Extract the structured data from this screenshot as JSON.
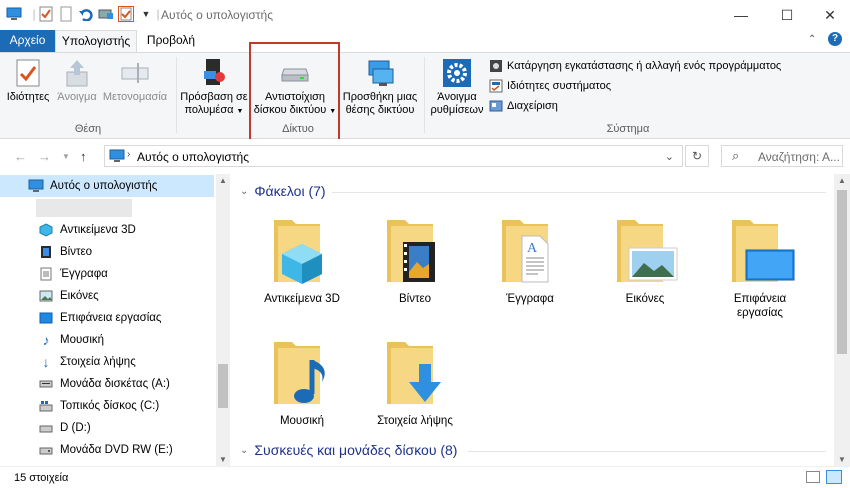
{
  "window": {
    "title": "Αυτός ο υπολογιστής",
    "minimize": "—",
    "maximize": "☐",
    "close": "✕"
  },
  "ribbon_tabs": [
    "Αρχείο",
    "Υπολογιστής",
    "Προβολή"
  ],
  "ribbon": {
    "location_group": {
      "label": "Θέση",
      "properties": "Ιδιότητες",
      "open": "Άνοιγμα",
      "rename": "Μετονομασία"
    },
    "network_group": {
      "label": "Δίκτυο",
      "media_access_1": "Πρόσβαση σε",
      "media_access_2": "πολυμέσα",
      "map_drive_1": "Αντιστοίχιση",
      "map_drive_2": "δίσκου δικτύου",
      "add_location_1": "Προσθήκη μιας",
      "add_location_2": "θέσης δικτύου"
    },
    "system_group": {
      "label": "Σύστημα",
      "open_settings_1": "Άνοιγμα",
      "open_settings_2": "ρυθμίσεων",
      "uninstall": "Κατάργηση εγκατάστασης ή αλλαγή ενός προγράμματος",
      "system_properties": "Ιδιότητες συστήματος",
      "manage": "Διαχείριση"
    }
  },
  "address": {
    "path": "Αυτός ο υπολογιστής",
    "search_placeholder": "Αναζήτηση: Α..."
  },
  "sidebar": {
    "items": [
      {
        "label": "Αυτός ο υπολογιστής"
      },
      {
        "label": ""
      },
      {
        "label": "Αντικείμενα 3D"
      },
      {
        "label": "Βίντεο"
      },
      {
        "label": "Έγγραφα"
      },
      {
        "label": "Εικόνες"
      },
      {
        "label": "Επιφάνεια εργασίας"
      },
      {
        "label": "Μουσική"
      },
      {
        "label": "Στοιχεία λήψης"
      },
      {
        "label": "Μονάδα δισκέτας (A:)"
      },
      {
        "label": "Τοπικός δίσκος (C:)"
      },
      {
        "label": "D (D:)"
      },
      {
        "label": "Μονάδα DVD RW (E:)"
      }
    ]
  },
  "main": {
    "folders_heading": "Φάκελοι (7)",
    "devices_heading": "Συσκευές και μονάδες δίσκου (8)",
    "folders": [
      {
        "label": "Αντικείμενα 3D"
      },
      {
        "label": "Βίντεο"
      },
      {
        "label": "Έγγραφα"
      },
      {
        "label": "Εικόνες"
      },
      {
        "label": "Επιφάνεια εργασίας"
      },
      {
        "label": "Μουσική"
      },
      {
        "label": "Στοιχεία λήψης"
      }
    ]
  },
  "status": {
    "item_count": "15 στοιχεία"
  },
  "colors": {
    "accent": "#1c6bb7",
    "folder": "#f3d37a",
    "highlight": "#c0392b"
  }
}
